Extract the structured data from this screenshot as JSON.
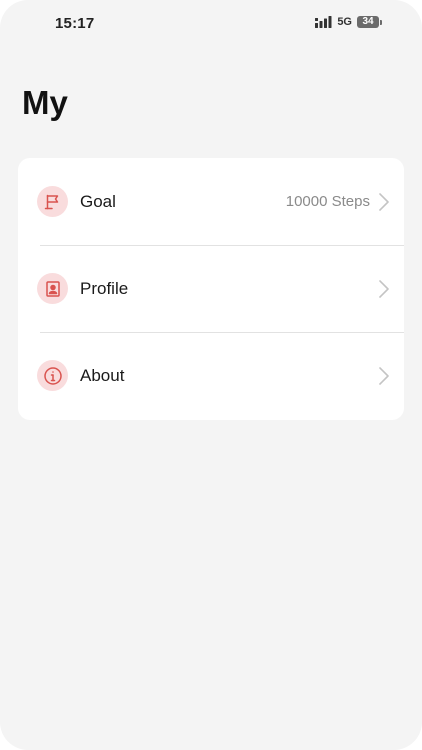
{
  "status_bar": {
    "time": "15:17",
    "network": "5G",
    "battery": "34"
  },
  "page": {
    "title": "My"
  },
  "menu": {
    "items": [
      {
        "label": "Goal",
        "value": "10000 Steps",
        "icon": "flag-icon"
      },
      {
        "label": "Profile",
        "value": "",
        "icon": "profile-card-icon"
      },
      {
        "label": "About",
        "value": "",
        "icon": "info-icon"
      }
    ]
  },
  "colors": {
    "background": "#f4f4f4",
    "card": "#ffffff",
    "icon_bg": "#f9dcdd",
    "icon_accent": "#d9534f",
    "value_text": "#8a8a8a",
    "chevron": "#c4c4c4"
  }
}
